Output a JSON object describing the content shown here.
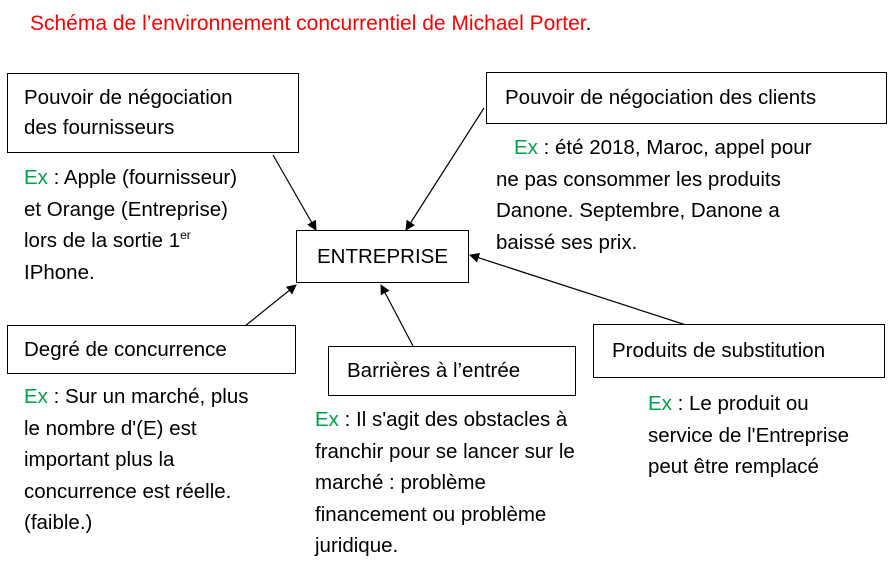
{
  "title": {
    "text": "Schéma de l’environnement concurrentiel de Michael Porter",
    "dot": ".",
    "color": "#ff0000"
  },
  "center": {
    "label": "ENTREPRISE"
  },
  "ex_label": "Ex",
  "ex_color": "#00a04a",
  "suppliers": {
    "box_line1": "Pouvoir de négociation",
    "box_line2": "des fournisseurs",
    "note_line1": " : Apple (fournisseur)",
    "note_line2": "et Orange (Entreprise)",
    "note_line3": "lors de la sortie 1",
    "note_sup": "er",
    "note_line4": "IPhone."
  },
  "clients": {
    "box": "Pouvoir de négociation des clients",
    "note_line1": " : été 2018, Maroc, appel pour",
    "note_line2": "ne pas consommer les produits",
    "note_line3": "Danone. Septembre, Danone a",
    "note_line4": "baissé ses prix."
  },
  "competition": {
    "box": "Degré de concurrence",
    "note_line1": " : Sur un marché, plus",
    "note_line2": "le nombre d'(E) est",
    "note_line3": "important plus la",
    "note_line4": "concurrence est réelle.",
    "note_line5": "(faible.)"
  },
  "barriers": {
    "box": "Barrières à  l’entrée",
    "note_line1": " : Il s'agit des obstacles à",
    "note_line2": "franchir pour se lancer sur le",
    "note_line3": "marché : problème",
    "note_line4": "financement ou problème",
    "note_line5": "juridique."
  },
  "substitutes": {
    "box": "Produits de substitution",
    "note_line1": " : Le produit ou",
    "note_line2": "service de l'Entreprise",
    "note_line3": "peut être remplacé"
  }
}
